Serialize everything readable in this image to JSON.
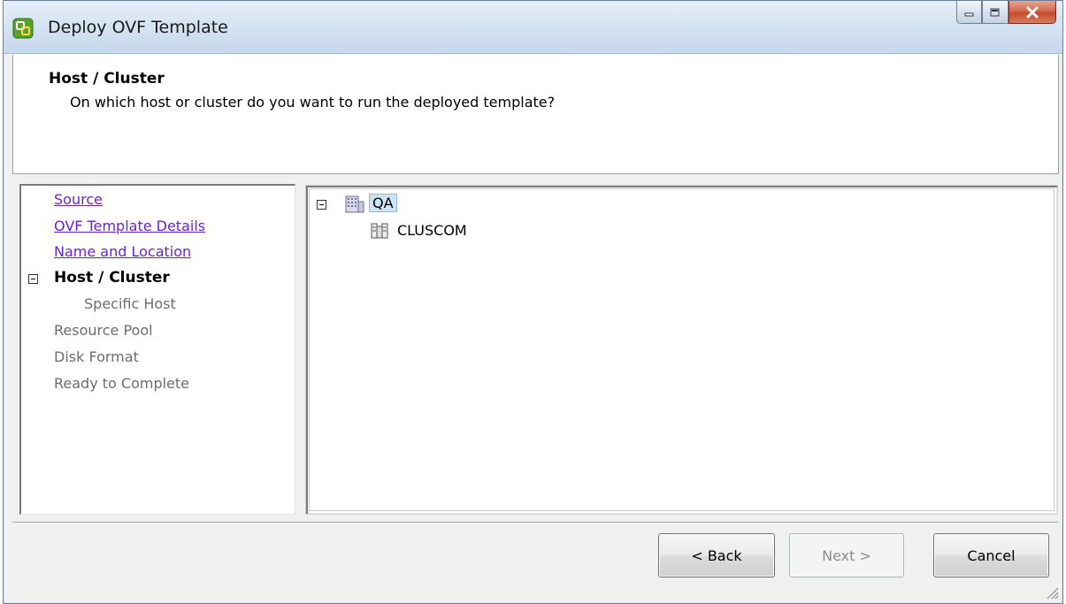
{
  "window": {
    "title": "Deploy OVF Template"
  },
  "header": {
    "title": "Host / Cluster",
    "subtitle": "On which host or cluster do you want to run the deployed template?"
  },
  "steps": [
    {
      "label": "Source",
      "state": "link"
    },
    {
      "label": "OVF Template Details",
      "state": "link"
    },
    {
      "label": "Name and Location",
      "state": "link"
    },
    {
      "label": "Host / Cluster",
      "state": "current"
    },
    {
      "label": "Specific Host",
      "state": "disabled"
    },
    {
      "label": "Resource Pool",
      "state": "disabled"
    },
    {
      "label": "Disk Format",
      "state": "disabled"
    },
    {
      "label": "Ready to Complete",
      "state": "disabled"
    }
  ],
  "tree": {
    "datacenter": {
      "label": "QA",
      "icon": "datacenter-icon",
      "selected": true
    },
    "cluster": {
      "label": "CLUSCOM",
      "icon": "cluster-icon"
    }
  },
  "buttons": {
    "back": "< Back",
    "next": "Next >",
    "cancel": "Cancel"
  },
  "colors": {
    "link": "#6b22d6",
    "disabled": "#6d6d6d",
    "selection": "#cde4f7"
  }
}
